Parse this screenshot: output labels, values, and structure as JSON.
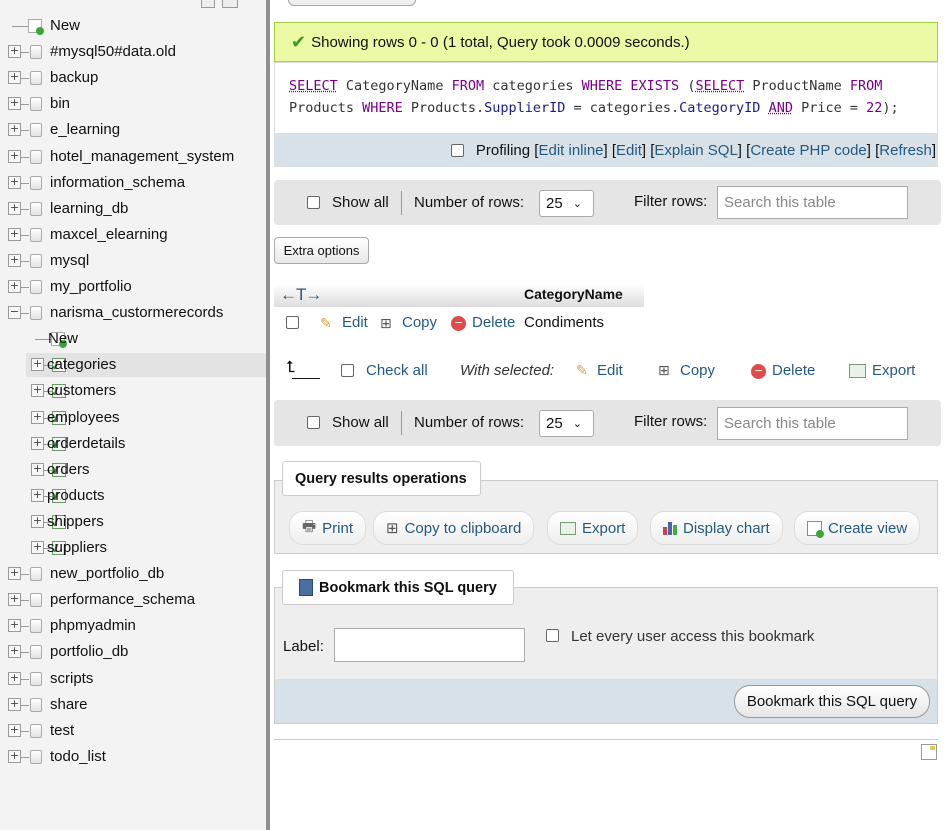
{
  "sidebar": {
    "items": [
      {
        "label": "New",
        "type": "new"
      },
      {
        "label": "#mysql50#data.old",
        "type": "db"
      },
      {
        "label": "backup",
        "type": "db"
      },
      {
        "label": "bin",
        "type": "db"
      },
      {
        "label": "e_learning",
        "type": "db"
      },
      {
        "label": "hotel_management_system",
        "type": "db"
      },
      {
        "label": "information_schema",
        "type": "db"
      },
      {
        "label": "learning_db",
        "type": "db"
      },
      {
        "label": "maxcel_elearning",
        "type": "db"
      },
      {
        "label": "mysql",
        "type": "db"
      },
      {
        "label": "my_portfolio",
        "type": "db"
      },
      {
        "label": "narisma_custormerecords",
        "type": "db-open"
      },
      {
        "label": "New",
        "type": "sub-new"
      },
      {
        "label": "categories",
        "type": "table",
        "selected": true
      },
      {
        "label": "customers",
        "type": "table"
      },
      {
        "label": "employees",
        "type": "table"
      },
      {
        "label": "orderdetails",
        "type": "table"
      },
      {
        "label": "orders",
        "type": "table"
      },
      {
        "label": "products",
        "type": "table"
      },
      {
        "label": "shippers",
        "type": "table"
      },
      {
        "label": "suppliers",
        "type": "table"
      },
      {
        "label": "new_portfolio_db",
        "type": "db"
      },
      {
        "label": "performance_schema",
        "type": "db"
      },
      {
        "label": "phpmyadmin",
        "type": "db"
      },
      {
        "label": "portfolio_db",
        "type": "db"
      },
      {
        "label": "scripts",
        "type": "db"
      },
      {
        "label": "share",
        "type": "db"
      },
      {
        "label": "test",
        "type": "db"
      },
      {
        "label": "todo_list",
        "type": "db"
      }
    ]
  },
  "result": {
    "message": "Showing rows 0 - 0 (1 total, Query took 0.0009 seconds.)"
  },
  "sql": {
    "t1": "SELECT",
    "t2": " CategoryName ",
    "t3": "FROM",
    "t4": " categories ",
    "t5": "WHERE EXISTS",
    "t6": " (",
    "t7": "SELECT",
    "t8": " ProductName ",
    "t9": "FROM",
    "u1": "Products ",
    "u2": "WHERE",
    "u3": " Products.",
    "u4": "SupplierID",
    "u5": " = categories.",
    "u6": "CategoryID",
    "u7": " ",
    "u8": "AND",
    "u9": " Price = ",
    "u10": "22",
    "u11": ");"
  },
  "profiling": {
    "label": "Profiling",
    "links": [
      "Edit inline",
      "Edit",
      "Explain SQL",
      "Create PHP code",
      "Refresh"
    ]
  },
  "nav_top": {
    "show_all": "Show all",
    "rows_label": "Number of rows:",
    "rows_value": "25",
    "filter_label": "Filter rows:",
    "filter_placeholder": "Search this table"
  },
  "extra_options": "Extra options",
  "table": {
    "arrows": "←T→",
    "column": "CategoryName",
    "row": {
      "edit": "Edit",
      "copy": "Copy",
      "delete": "Delete",
      "value": "Condiments"
    }
  },
  "bulk": {
    "check_all": "Check all",
    "with_selected": "With selected:",
    "edit": "Edit",
    "copy": "Copy",
    "delete": "Delete",
    "export": "Export"
  },
  "nav_bottom": {
    "show_all": "Show all",
    "rows_label": "Number of rows:",
    "rows_value": "25",
    "filter_label": "Filter rows:",
    "filter_placeholder": "Search this table"
  },
  "qro": {
    "title": "Query results operations",
    "print": "Print",
    "copy": "Copy to clipboard",
    "export": "Export",
    "chart": "Display chart",
    "view": "Create view"
  },
  "bookmark": {
    "title": "Bookmark this SQL query",
    "label": "Label:",
    "share": "Let every user access this bookmark",
    "submit": "Bookmark this SQL query"
  }
}
